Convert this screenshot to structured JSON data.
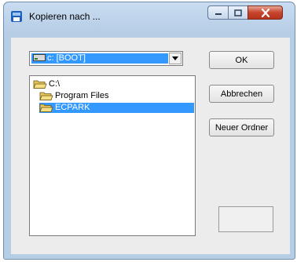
{
  "window": {
    "title": "Kopieren nach ...",
    "icons": {
      "app": "app-icon",
      "minimize": "minimize-icon",
      "maximize": "maximize-icon",
      "close": "close-icon"
    }
  },
  "drive_select": {
    "value": "c: [BOOT]",
    "icon": "drive-icon",
    "arrow_icon": "chevron-down-icon"
  },
  "folder_tree": [
    {
      "label": "C:\\",
      "icon": "open-folder-icon",
      "selected": false
    },
    {
      "label": "Program Files",
      "icon": "open-folder-icon",
      "selected": false
    },
    {
      "label": "ECPARK",
      "icon": "open-folder-icon",
      "selected": true
    }
  ],
  "buttons": {
    "ok": "OK",
    "cancel": "Abbrechen",
    "new_folder": "Neuer Ordner"
  },
  "colors": {
    "selection": "#3399ff",
    "close_button": "#c7452d"
  }
}
